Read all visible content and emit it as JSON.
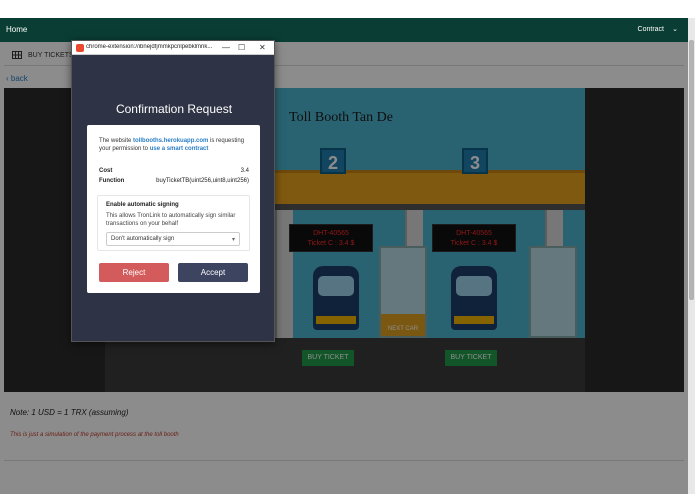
{
  "nav": {
    "home": "Home",
    "contract": "Contract",
    "chevron": "⌄"
  },
  "tabs": {
    "buy_tickets": "BUY TICKETS"
  },
  "back": "‹ back",
  "scene": {
    "title": "Toll Booth Tan De",
    "lane2": "2",
    "lane3": "3",
    "led2_line1": "DHT-40565",
    "led2_line2": "Ticket C : 3.4 $",
    "led3_line1": "DHT-40565",
    "led3_line2": "Ticket C : 3.4 $",
    "next_car": "NEXT CAR",
    "buy_ticket_1": "BUY TICKET",
    "buy_ticket_2": "BUY TICKET"
  },
  "note": "Note: 1 USD = 1 TRX (assuming)",
  "simulation": "This is just a simulation of the payment process at the toll booth",
  "popup": {
    "url": "chrome-extension://ibnejdfjmmkpcnlpebklmnk...",
    "minimize": "—",
    "maximize": "☐",
    "close": "✕",
    "title": "Confirmation Request",
    "text_pre": "The website ",
    "site": "tollbooths.herokuapp.com",
    "text_mid": " is requesting your permission to ",
    "link": "use a smart contract",
    "cost_label": "Cost",
    "cost_value": "3.4",
    "function_label": "Function",
    "function_value": "buyTicketTB(uint256,uint8,uint256)",
    "signing_title": "Enable automatic signing",
    "signing_desc": "This allows TronLink to automatically sign similar transactions on your behalf",
    "select_value": "Don't automatically sign",
    "reject": "Reject",
    "accept": "Accept"
  },
  "colors": {
    "navbar": "#0a3d33",
    "reject": "#d35b5b",
    "accept": "#3c4460",
    "buy_ticket": "#1f9c4a",
    "popup_bg": "#2e3345"
  }
}
